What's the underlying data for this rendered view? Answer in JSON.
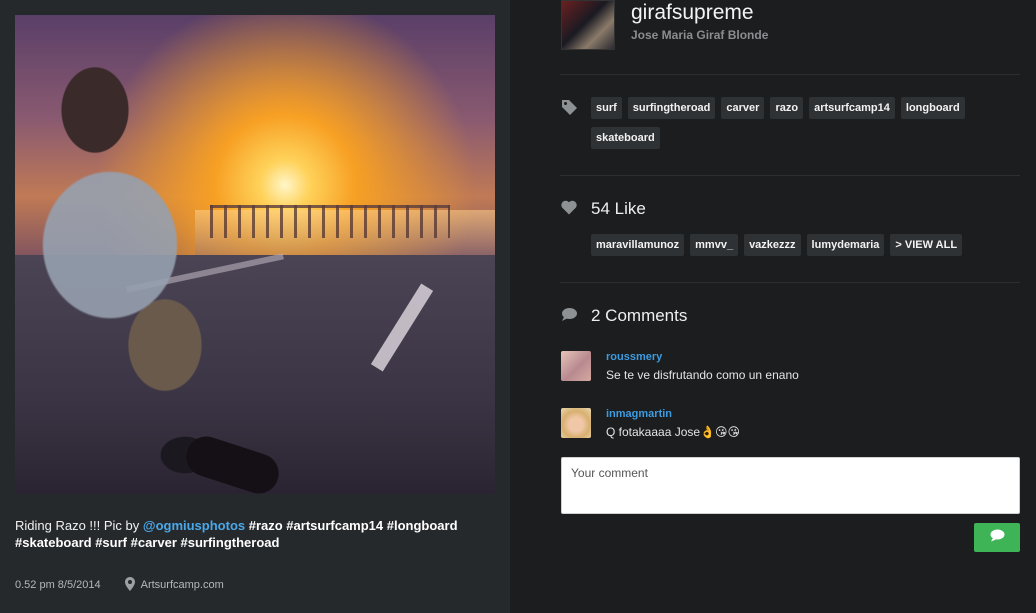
{
  "post": {
    "caption_prefix": "Riding Razo !!! Pic by ",
    "caption_mention": "@ogmiusphotos",
    "caption_tags_line1": " #razo #artsurfcamp14 #longboard",
    "caption_tags_line2": "#skateboard #surf #carver #surfingtheroad",
    "timestamp": "0.52 pm 8/5/2014",
    "location": "Artsurfcamp.com"
  },
  "profile": {
    "username": "girafsupreme",
    "full_name": "Jose Maria Giraf Blonde"
  },
  "tags": [
    "surf",
    "surfingtheroad",
    "carver",
    "razo",
    "artsurfcamp14",
    "longboard",
    "skateboard"
  ],
  "likes": {
    "label": "54 Like",
    "users": [
      "maravillamunoz",
      "mmvv_",
      "vazkezzz",
      "lumydemaria"
    ],
    "view_all": "> VIEW ALL"
  },
  "comments": {
    "label": "2 Comments",
    "items": [
      {
        "user": "roussmery",
        "text": "Se te ve disfrutando como un enano"
      },
      {
        "user": "inmagmartin",
        "text": "Q fotakaaaa Jose👌😘😘"
      }
    ],
    "input_placeholder": "Your comment"
  },
  "colors": {
    "accent_blue": "#3d9be0",
    "send_green": "#3fb456"
  }
}
